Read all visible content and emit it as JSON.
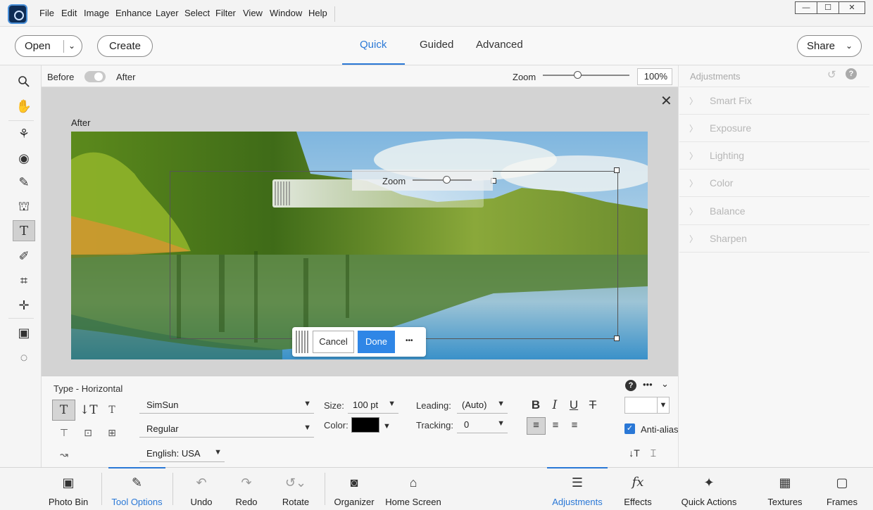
{
  "menu": {
    "items": [
      "File",
      "Edit",
      "Image",
      "Enhance",
      "Layer",
      "Select",
      "Filter",
      "View",
      "Window",
      "Help"
    ]
  },
  "window_controls": {
    "minimize": "—",
    "maximize": "☐",
    "close": "✕"
  },
  "topbar": {
    "open_label": "Open",
    "create_label": "Create",
    "modes": [
      "Quick",
      "Guided",
      "Advanced"
    ],
    "active_mode": "Quick",
    "share_label": "Share"
  },
  "beforeafter": {
    "before_label": "Before",
    "after_label": "After",
    "zoom_label": "Zoom",
    "zoom_value": "100%",
    "zoom_level": 0.4
  },
  "canvas": {
    "view_label": "After",
    "floating_zoom_label": "Zoom",
    "cancel_label": "Cancel",
    "done_label": "Done",
    "more_label": "•••"
  },
  "adjustments": {
    "title": "Adjustments",
    "items": [
      "Smart Fix",
      "Exposure",
      "Lighting",
      "Color",
      "Balance",
      "Sharpen"
    ]
  },
  "tool_options": {
    "type_label": "Type - Horizontal",
    "font_family": "SimSun",
    "font_style": "Regular",
    "language": "English: USA",
    "size_label": "Size:",
    "size_value": "100 pt",
    "color_label": "Color:",
    "color_value": "#000000",
    "leading_label": "Leading:",
    "leading_value": "(Auto)",
    "tracking_label": "Tracking:",
    "tracking_value": "0",
    "bold": "B",
    "italic": "I",
    "underline": "U",
    "strikethrough": "T",
    "antialias_label": "Anti-alias",
    "antialias_checked": true
  },
  "bottombar": {
    "left": [
      {
        "label": "Photo Bin",
        "icon": "photo-bin-icon"
      },
      {
        "label": "Tool Options",
        "icon": "tool-options-icon",
        "active": true
      },
      {
        "label": "Undo",
        "icon": "undo-icon"
      },
      {
        "label": "Redo",
        "icon": "redo-icon"
      },
      {
        "label": "Rotate",
        "icon": "rotate-icon"
      },
      {
        "label": "Organizer",
        "icon": "organizer-icon"
      },
      {
        "label": "Home Screen",
        "icon": "home-icon"
      }
    ],
    "right": [
      {
        "label": "Adjustments",
        "icon": "adjustments-icon",
        "active": true
      },
      {
        "label": "Effects",
        "icon": "effects-icon"
      },
      {
        "label": "Quick Actions",
        "icon": "quick-actions-icon"
      },
      {
        "label": "Textures",
        "icon": "textures-icon"
      },
      {
        "label": "Frames",
        "icon": "frames-icon"
      }
    ]
  },
  "colors": {
    "accent": "#2a78d6",
    "done_button": "#2f86e6"
  }
}
